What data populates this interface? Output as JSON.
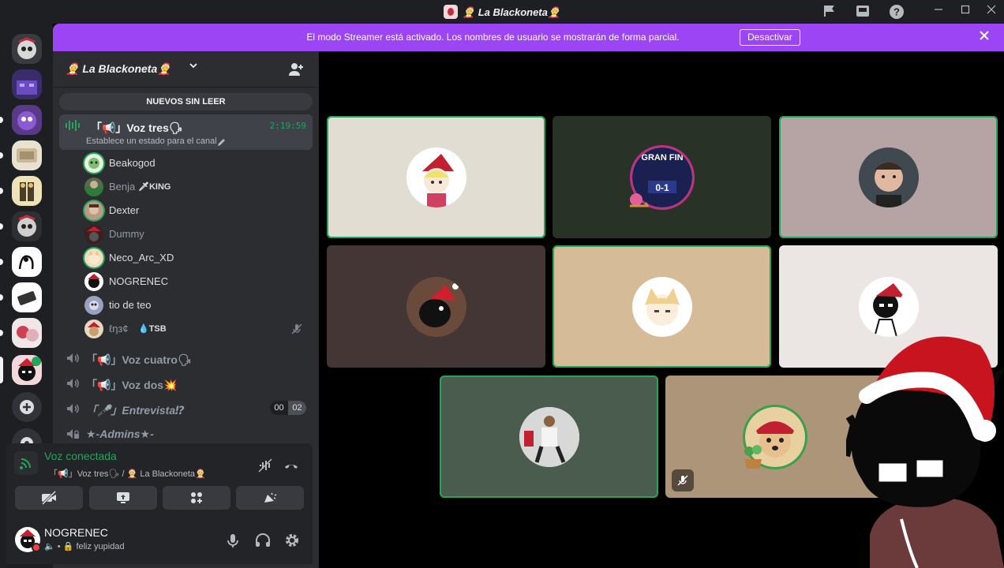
{
  "titlebar": {
    "title": "🤶 La Blackoneta🤶"
  },
  "banner": {
    "message": "El modo Streamer está activado. Los nombres de usuario se mostrarán de forma parcial.",
    "button": "Desactivar"
  },
  "guild": {
    "name": "🤶 La Blackoneta🤶"
  },
  "unread": {
    "label": "NUEVOS SIN LEER"
  },
  "active_channel": {
    "name": "「📢」Voz tres🗣",
    "status": "Establece un estado para el canal",
    "timer": "2:19:59"
  },
  "members": [
    {
      "name": "Beakogod",
      "tag": ""
    },
    {
      "name": "Benja",
      "tag": "🗡KING"
    },
    {
      "name": "Dexter",
      "tag": ""
    },
    {
      "name": "Dummy",
      "tag": ""
    },
    {
      "name": "Neco_Arc_XD",
      "tag": ""
    },
    {
      "name": "NOGRENEC",
      "tag": ""
    },
    {
      "name": "tio de teo",
      "tag": ""
    },
    {
      "name": "ℓηз¢",
      "tag": "💧TSB"
    }
  ],
  "voice_channels": [
    {
      "name": "「📢」Voz cuatro🗣",
      "count": ""
    },
    {
      "name": "「📢」Voz dos💥",
      "count": ""
    },
    {
      "name": "「🎤」Entrevista⁉",
      "count_a": "00",
      "count_b": "02"
    },
    {
      "name": "★-Admins★-",
      "count": ""
    }
  ],
  "voice_panel": {
    "status": "Voz conectada",
    "location": "「📢」Voz tres🗣 / 🤶 La Blackoneta🤶"
  },
  "user": {
    "name": "NOGRENEC",
    "status": "feliz yupidad"
  },
  "colors": {
    "accent": "#9b45f5",
    "speaking": "#23a55a",
    "sidebar": "#2b2d31",
    "rail": "#1e1f22"
  }
}
